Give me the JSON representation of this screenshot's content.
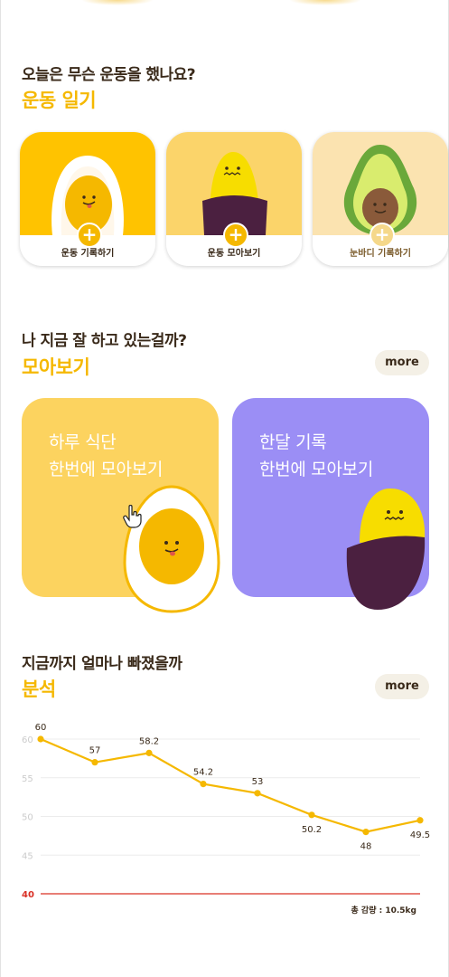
{
  "diary": {
    "subtitle": "오늘은 무슨 운동을 했나요?",
    "title": "운동 일기",
    "cards": [
      {
        "label": "운동 기록하기"
      },
      {
        "label": "운동 모아보기"
      },
      {
        "label": "눈바디 기록하기"
      }
    ]
  },
  "collection": {
    "subtitle": "나 지금 잘 하고 있는걸까?",
    "title": "모아보기",
    "more": "more",
    "tiles": [
      {
        "line1": "하루 식단",
        "line2": "한번에 모아보기",
        "color": "#fcd35f"
      },
      {
        "line1": "한달 기록",
        "line2": "한번에 모아보기",
        "color": "#9b8ef5"
      }
    ]
  },
  "analysis": {
    "subtitle": "지금까지 얼마나 빠졌을까",
    "title": "분석",
    "more": "more",
    "total": "총 감량 : 10.5kg"
  },
  "chart_data": {
    "type": "line",
    "series": [
      {
        "values": [
          60,
          57,
          58.2,
          54.2,
          53,
          50.2,
          48,
          49.5
        ],
        "color": "#f5b800"
      }
    ],
    "data_labels": [
      "60",
      "57",
      "58.2",
      "54.2",
      "53",
      "50.2",
      "48",
      "49.5"
    ],
    "y_ticks": [
      "60",
      "55",
      "50",
      "45",
      "40"
    ],
    "ylim": [
      40,
      60
    ],
    "target_line": {
      "value": 40,
      "color": "#d93025"
    },
    "grid": true
  }
}
